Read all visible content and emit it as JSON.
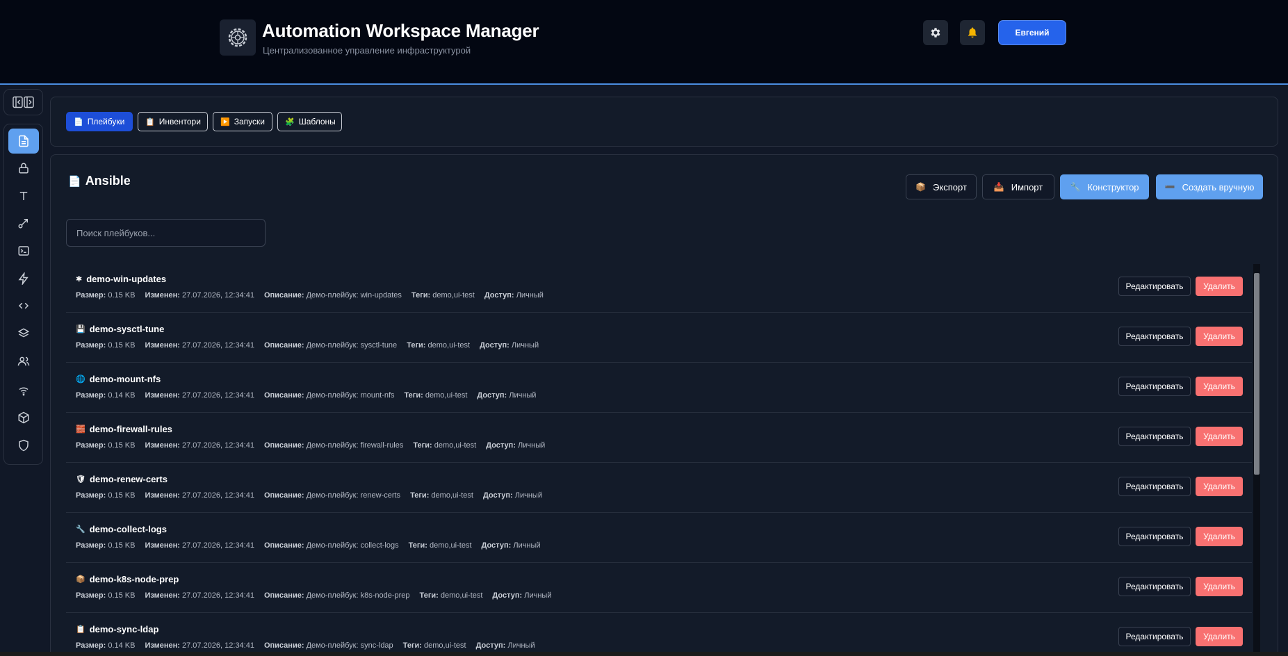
{
  "header": {
    "title": "Automation Workspace Manager",
    "subtitle": "Централизованное управление инфраструктурой",
    "logo_icon": "gear-logo-icon",
    "settings_icon": "gear-icon",
    "notifications_icon": "bell-icon",
    "user_label": "Евгений"
  },
  "sidebar": {
    "toggle_icon": "collapse-expand-icon",
    "items": [
      {
        "name": "document",
        "icon": "document-icon",
        "active": true
      },
      {
        "name": "lock",
        "icon": "lock-icon"
      },
      {
        "name": "text",
        "icon": "type-icon"
      },
      {
        "name": "route",
        "icon": "arrow-diagonal-icon"
      },
      {
        "name": "terminal",
        "icon": "terminal-icon"
      },
      {
        "name": "lightning",
        "icon": "lightning-icon"
      },
      {
        "name": "code",
        "icon": "code-icon"
      },
      {
        "name": "layers",
        "icon": "layers-icon"
      },
      {
        "name": "users",
        "icon": "users-icon"
      },
      {
        "name": "wifi",
        "icon": "wifi-icon"
      },
      {
        "name": "package",
        "icon": "cube-icon"
      },
      {
        "name": "shield",
        "icon": "shield-icon"
      }
    ]
  },
  "tabs": [
    {
      "icon": "📄",
      "label": "Плейбуки",
      "active": true
    },
    {
      "icon": "📋",
      "label": "Инвентори"
    },
    {
      "icon": "▶️",
      "label": "Запуски"
    },
    {
      "icon": "🧩",
      "label": "Шаблоны"
    }
  ],
  "section": {
    "icon": "📄",
    "title": "Ansible",
    "actions": {
      "export_icon": "📦",
      "export": "Экспорт",
      "import_icon": "📥",
      "import": "Импорт",
      "builder_icon": "🔧",
      "builder": "Конструктор",
      "manual_icon": "➖",
      "manual": "Создать вручную"
    },
    "search_placeholder": "Поиск плейбуков..."
  },
  "labels": {
    "size": "Размер:",
    "modified": "Изменен:",
    "description": "Описание:",
    "tags": "Теги:",
    "access": "Доступ:",
    "edit": "Редактировать",
    "delete": "Удалить"
  },
  "playbooks": [
    {
      "icon": "✱",
      "name": "demo-win-updates",
      "size": "0.15 KB",
      "modified": "27.07.2026, 12:34:41",
      "description": "Демо-плейбук: win-updates",
      "tags": "demo,ui-test",
      "access": "Личный"
    },
    {
      "icon": "💾",
      "name": "demo-sysctl-tune",
      "size": "0.15 KB",
      "modified": "27.07.2026, 12:34:41",
      "description": "Демо-плейбук: sysctl-tune",
      "tags": "demo,ui-test",
      "access": "Личный"
    },
    {
      "icon": "🌐",
      "name": "demo-mount-nfs",
      "size": "0.14 KB",
      "modified": "27.07.2026, 12:34:41",
      "description": "Демо-плейбук: mount-nfs",
      "tags": "demo,ui-test",
      "access": "Личный"
    },
    {
      "icon": "🧱",
      "name": "demo-firewall-rules",
      "size": "0.15 KB",
      "modified": "27.07.2026, 12:34:41",
      "description": "Демо-плейбук: firewall-rules",
      "tags": "demo,ui-test",
      "access": "Личный"
    },
    {
      "icon": "🛡",
      "name": "demo-renew-certs",
      "size": "0.15 KB",
      "modified": "27.07.2026, 12:34:41",
      "description": "Демо-плейбук: renew-certs",
      "tags": "demo,ui-test",
      "access": "Личный"
    },
    {
      "icon": "🔧",
      "name": "demo-collect-logs",
      "size": "0.15 KB",
      "modified": "27.07.2026, 12:34:41",
      "description": "Демо-плейбук: collect-logs",
      "tags": "demo,ui-test",
      "access": "Личный"
    },
    {
      "icon": "📦",
      "name": "demo-k8s-node-prep",
      "size": "0.15 KB",
      "modified": "27.07.2026, 12:34:41",
      "description": "Демо-плейбук: k8s-node-prep",
      "tags": "demo,ui-test",
      "access": "Личный"
    },
    {
      "icon": "📋",
      "name": "demo-sync-ldap",
      "size": "0.14 KB",
      "modified": "27.07.2026, 12:34:41",
      "description": "Демо-плейбук: sync-ldap",
      "tags": "demo,ui-test",
      "access": "Личный"
    }
  ],
  "colors": {
    "accent": "#2563eb",
    "accent_light": "#5fa0ef",
    "danger": "#f87171",
    "background": "#111827"
  }
}
